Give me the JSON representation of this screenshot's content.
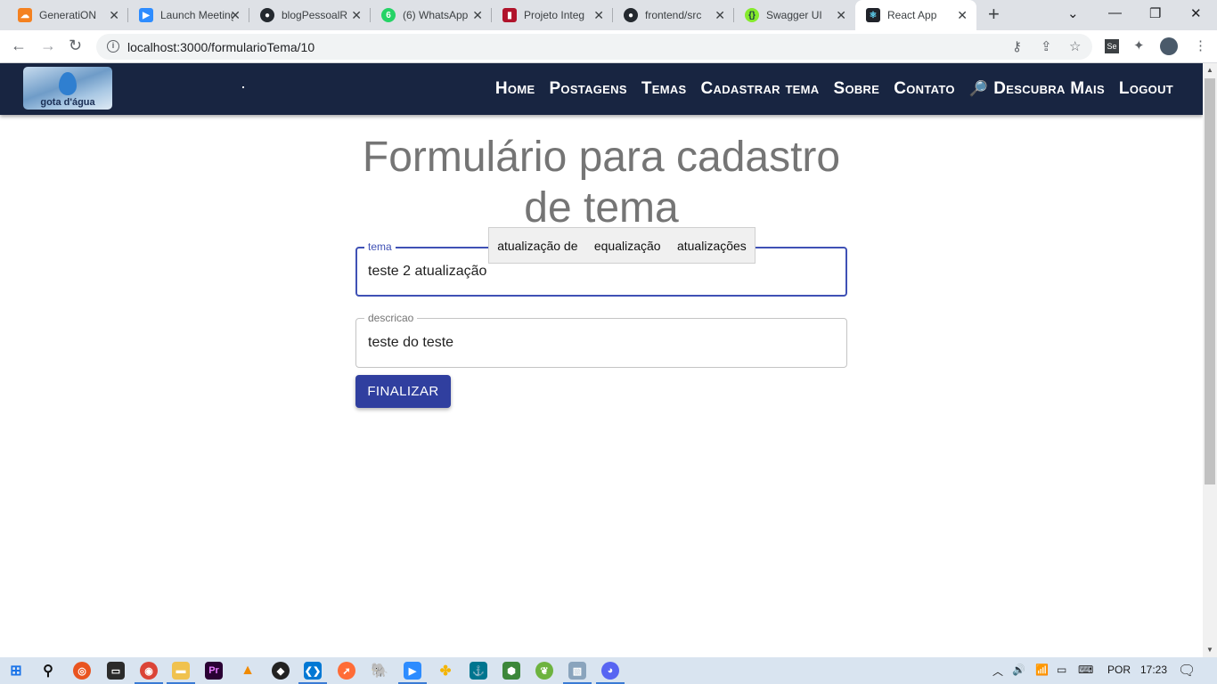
{
  "browser": {
    "tabs": [
      {
        "title": "GeneratiON",
        "icon": "cloud-icon",
        "color": "#f48120"
      },
      {
        "title": "Launch Meeting",
        "icon": "zoom-icon",
        "color": "#2d8cff"
      },
      {
        "title": "blogPessoalR",
        "icon": "github-icon",
        "color": "#24292f"
      },
      {
        "title": "(6) WhatsApp",
        "icon": "whatsapp-icon",
        "color": "#25d366"
      },
      {
        "title": "Projeto Integ",
        "icon": "trello-icon",
        "color": "#b0132b"
      },
      {
        "title": "frontend/src",
        "icon": "github-icon",
        "color": "#24292f"
      },
      {
        "title": "Swagger UI",
        "icon": "swagger-icon",
        "color": "#85ea2d"
      },
      {
        "title": "React App",
        "icon": "react-icon",
        "color": "#20232a"
      }
    ],
    "url": "localhost:3000/formularioTema/10"
  },
  "navbar": {
    "logo_text": "gota d'água",
    "items": [
      "Home",
      "Postagens",
      "Temas",
      "Cadastrar tema",
      "Sobre",
      "Contato",
      "Descubra Mais",
      "Logout"
    ]
  },
  "form": {
    "title": "Formulário para cadastro de tema",
    "tema_label": "tema",
    "tema_value": "teste 2 atualização",
    "descricao_label": "descricao",
    "descricao_value": "teste do teste",
    "submit_label": "FINALIZAR",
    "suggestions": [
      "atualização de",
      "equalização",
      "atualizações"
    ]
  },
  "taskbar": {
    "language": "POR",
    "time": "17:23"
  }
}
